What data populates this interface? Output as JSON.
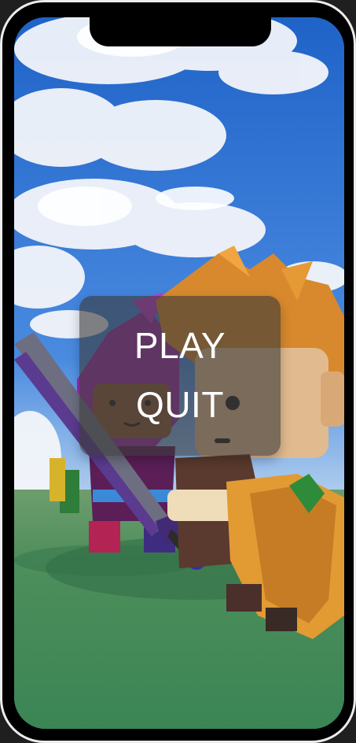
{
  "menu": {
    "play_label": "PLAY",
    "quit_label": "QUIT"
  },
  "colors": {
    "sky": "#2f78d8",
    "grass": "#3f8f58",
    "panel": "#3a3a3a",
    "text": "#ffffff"
  }
}
